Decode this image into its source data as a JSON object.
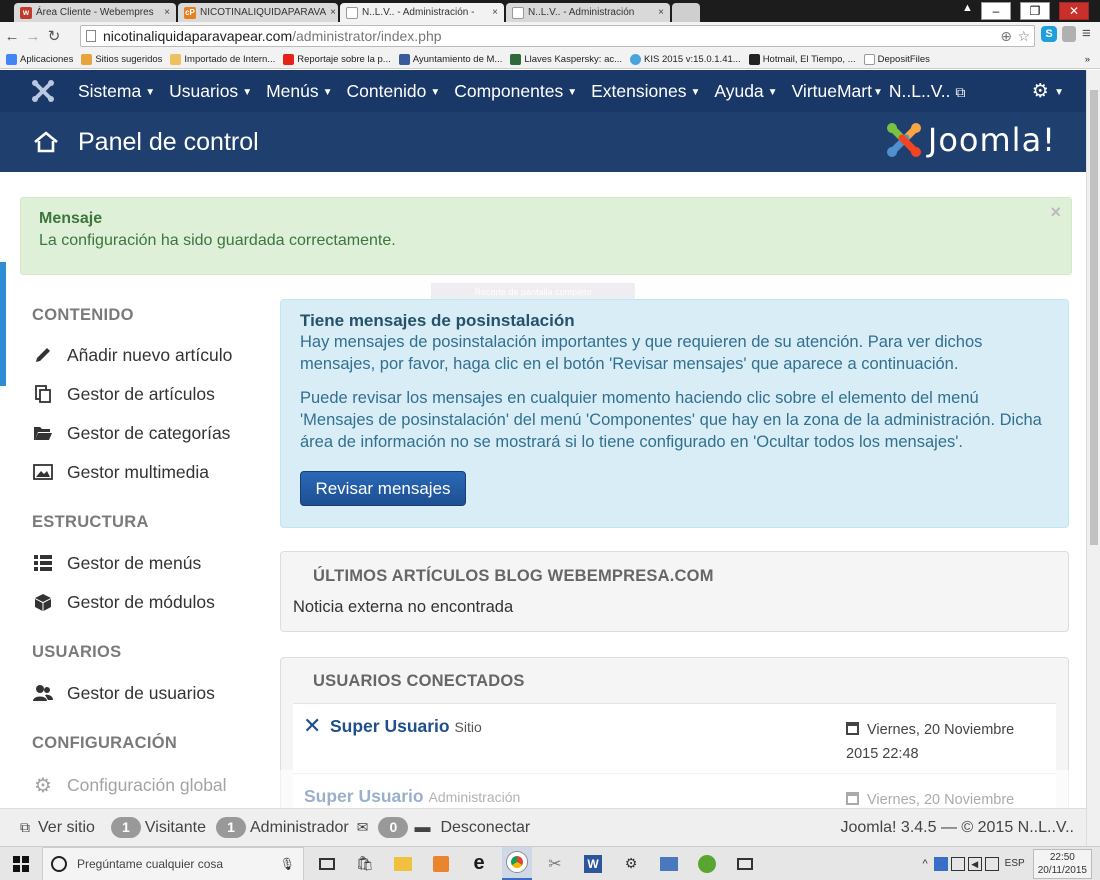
{
  "browser": {
    "tabs": [
      {
        "label": "Área Cliente - Webempres",
        "color": "#c0392b",
        "fav": "w"
      },
      {
        "label": "NICOTINALIQUIDAPARAVA",
        "color": "#e67e22",
        "fav": "cP"
      },
      {
        "label": "N..L.V.. - Administración -",
        "color": "#ffffff",
        "fav": ""
      },
      {
        "label": "N..L.V.. - Administración",
        "color": "#ffffff",
        "fav": ""
      }
    ],
    "url_host": "nicotinaliquidaparavapear.com",
    "url_path": "/administrator/index.php",
    "bookmarks": [
      {
        "label": "Aplicaciones",
        "color": "#4285f4"
      },
      {
        "label": "Sitios sugeridos",
        "color": "#e8a33c"
      },
      {
        "label": "Importado de Intern...",
        "color": "#f0c060"
      },
      {
        "label": "Reportaje sobre la p...",
        "color": "#e62117"
      },
      {
        "label": "Ayuntamiento de M...",
        "color": "#3a5a9c"
      },
      {
        "label": "Llaves Kaspersky: ac...",
        "color": "#2f6b3a"
      },
      {
        "label": "KIS 2015 v:15.0.1.41...",
        "color": "#4aa3df"
      },
      {
        "label": "Hotmail, El Tiempo, ...",
        "color": "#222222"
      },
      {
        "label": "DepositFiles",
        "color": "#dddddd"
      }
    ]
  },
  "topnav": {
    "items": [
      "Sistema",
      "Usuarios",
      "Menús",
      "Contenido",
      "Componentes",
      "Extensiones",
      "Ayuda",
      "VirtueMart"
    ],
    "site_name": "N..L..V.."
  },
  "title": "Panel de control",
  "brand": "Joomla!",
  "message": {
    "heading": "Mensaje",
    "text": "La configuración ha sido guardada correctamente."
  },
  "overlay_tip": "Recorte de pantalla completo",
  "sidebar": {
    "sections": [
      {
        "title": "CONTENIDO",
        "items": [
          {
            "label": "Añadir nuevo artículo",
            "icon": "pencil-icon"
          },
          {
            "label": "Gestor de artículos",
            "icon": "copy-icon"
          },
          {
            "label": "Gestor de categorías",
            "icon": "folder-icon"
          },
          {
            "label": "Gestor multimedia",
            "icon": "image-icon"
          }
        ]
      },
      {
        "title": "ESTRUCTURA",
        "items": [
          {
            "label": "Gestor de menús",
            "icon": "list-icon"
          },
          {
            "label": "Gestor de módulos",
            "icon": "cube-icon"
          }
        ]
      },
      {
        "title": "USUARIOS",
        "items": [
          {
            "label": "Gestor de usuarios",
            "icon": "users-icon"
          }
        ]
      },
      {
        "title": "CONFIGURACIÓN",
        "items": [
          {
            "label": "Configuración global",
            "icon": "gear-icon"
          }
        ]
      }
    ]
  },
  "postinstall": {
    "title": "Tiene mensajes de posinstalación",
    "p1": "Hay mensajes de posinstalación importantes y que requieren de su atención. Para ver dichos mensajes, por favor, haga clic en el botón 'Revisar mensajes' que aparece a continuación.",
    "p2": "Puede revisar los mensajes en cualquier momento haciendo clic sobre el elemento del menú 'Mensajes de posinstalación' del menú 'Componentes' que hay en la zona de la administración. Dicha área de información no se mostrará si lo tiene configurado en 'Ocultar todos los mensajes'.",
    "button": "Revisar mensajes"
  },
  "blog": {
    "heading": "ÚLTIMOS ARTÍCULOS BLOG WEBEMPRESA.COM",
    "body": "Noticia externa no encontrada"
  },
  "users": {
    "heading": "USUARIOS CONECTADOS",
    "rows": [
      {
        "name": "Super Usuario",
        "where": "Sitio",
        "date_line1": "Viernes, 20 Noviembre",
        "date_line2": "2015 22:48"
      },
      {
        "name": "Super Usuario",
        "where": "Administración",
        "date_line1": "Viernes, 20 Noviembre",
        "date_line2": ""
      }
    ]
  },
  "statusbar": {
    "view_site": "Ver sitio",
    "visitors_count": "1",
    "visitors_label": "Visitante",
    "admins_count": "1",
    "admins_label": "Administrador",
    "messages_count": "0",
    "logout": "Desconectar",
    "version": "Joomla! 3.4.5  —  © 2015 N..L..V.."
  },
  "taskbar": {
    "search_placeholder": "Pregúntame cualquier cosa",
    "lang": "ESP",
    "time": "22:50",
    "date": "20/11/2015"
  }
}
